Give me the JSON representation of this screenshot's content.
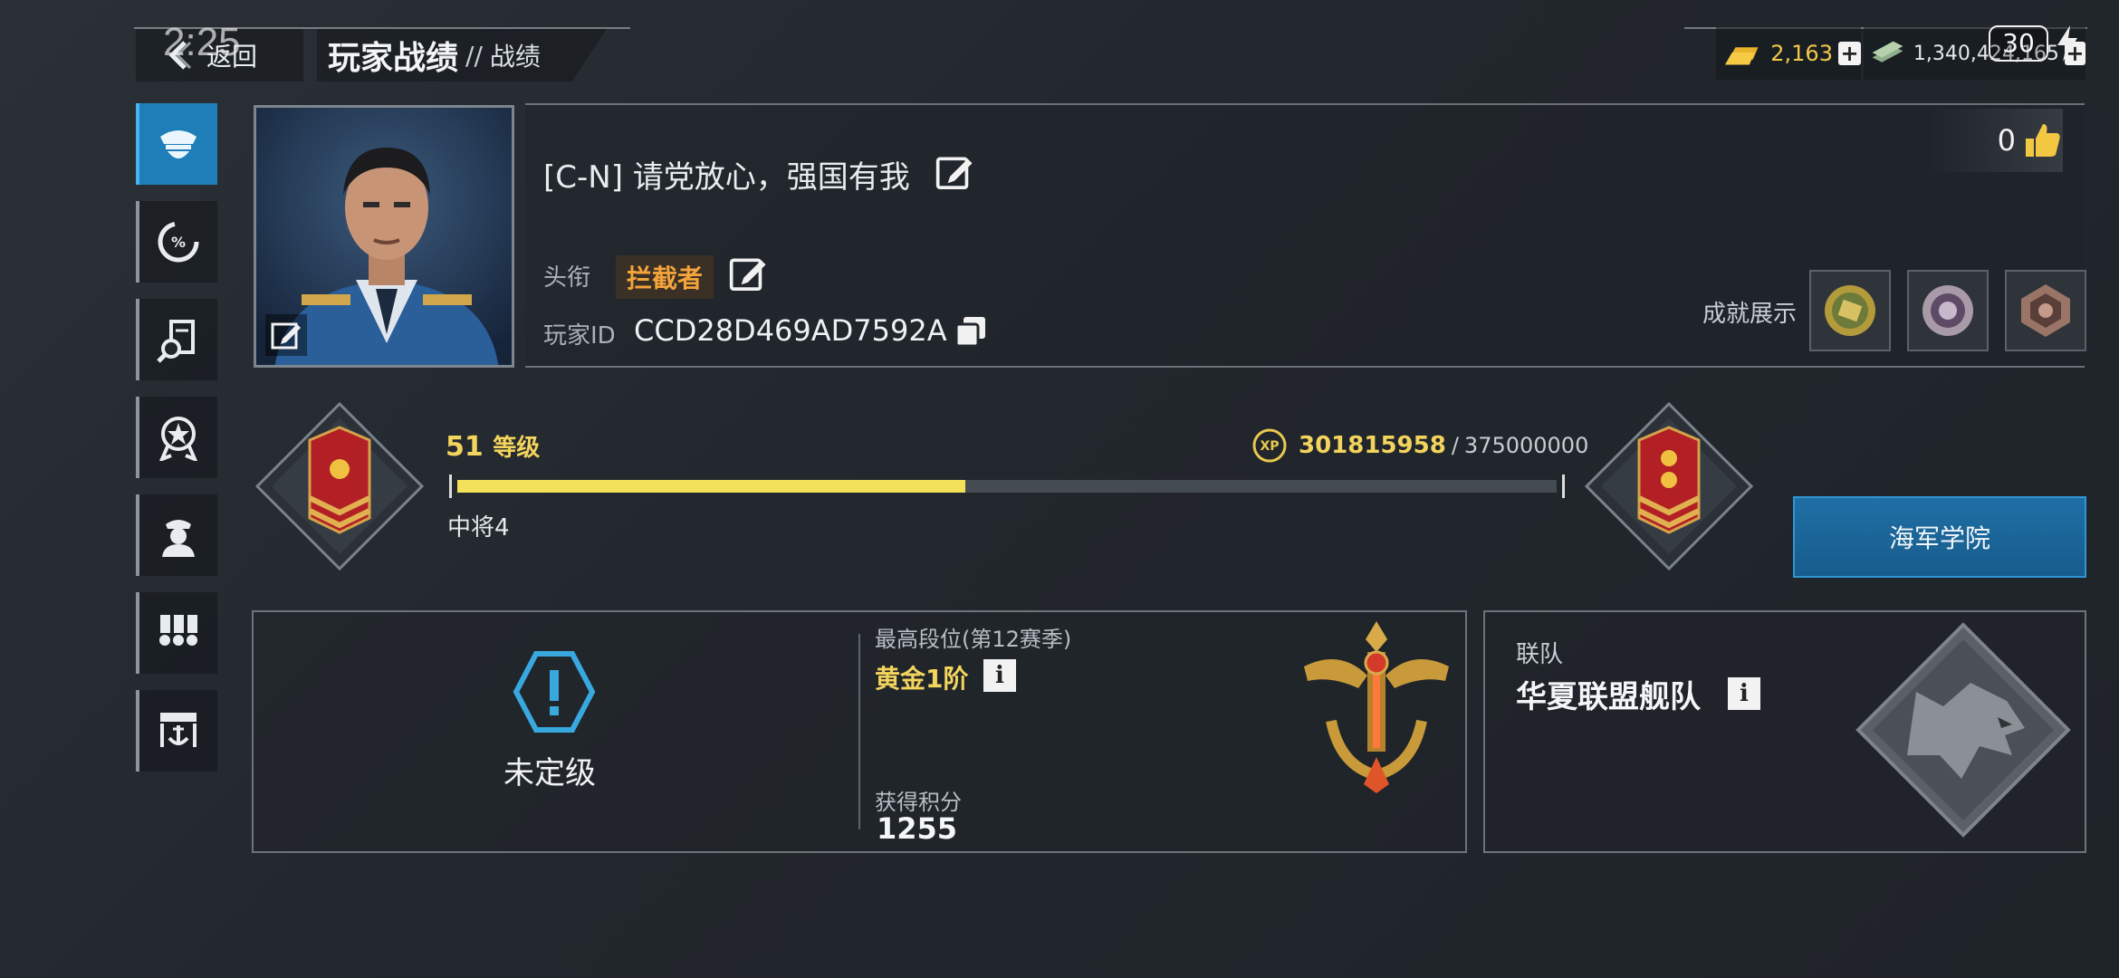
{
  "status": {
    "time": "2:25",
    "badge": "30"
  },
  "header": {
    "back_label": "返回",
    "title": "玩家战绩",
    "separator": "//",
    "subtitle": "战绩"
  },
  "resources": {
    "gold": "2,163",
    "cash": "1,340,424,165"
  },
  "sidebar": {
    "items": [
      {
        "name": "profile",
        "icon": "officer-cap-icon",
        "active": true
      },
      {
        "name": "stats",
        "icon": "percent-chart-icon",
        "active": false
      },
      {
        "name": "ship-search",
        "icon": "ship-magnifier-icon",
        "active": false
      },
      {
        "name": "achievements",
        "icon": "star-medal-icon",
        "active": false
      },
      {
        "name": "crew",
        "icon": "sailor-icon",
        "active": false
      },
      {
        "name": "medals",
        "icon": "ribbons-icon",
        "active": false
      },
      {
        "name": "harbor",
        "icon": "anchor-harbor-icon",
        "active": false
      }
    ]
  },
  "profile": {
    "name": "[C-N] 请党放心，强国有我",
    "title_label": "头衔",
    "title_value": "拦截者",
    "id_label": "玩家ID",
    "id_value": "CCD28D469AD7592A",
    "likes": "0",
    "achievements_label": "成就展示"
  },
  "rank": {
    "level": "51",
    "level_suffix": "等级",
    "xp_current": "301815958",
    "xp_separator": "/",
    "xp_max": "375000000",
    "xp_progress": 0.462,
    "rank_name": "中将4",
    "naval_academy": "海军学院"
  },
  "ranked": {
    "unranked_label": "未定级",
    "season_label": "最高段位(第12赛季)",
    "tier": "黄金1阶",
    "points_label": "获得积分",
    "points": "1255"
  },
  "league": {
    "label": "联队",
    "name": "华夏联盟舰队"
  },
  "colors": {
    "accent_blue": "#1e7fb8",
    "gold_text": "#f3d45c",
    "title_orange": "#f4a43a",
    "xp_fill": "#f4e15a"
  }
}
